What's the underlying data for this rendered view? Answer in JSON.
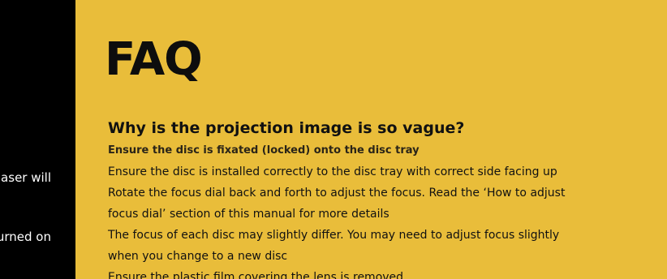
{
  "sidebar": {
    "lines": [
      "laser will",
      "urned on"
    ]
  },
  "faq": {
    "title": "FAQ",
    "question": "Why is the projection image is so vague?",
    "subheading": "Ensure the disc is fixated (locked) onto the disc tray",
    "lines": [
      "Ensure the disc is installed correctly to the disc tray with correct side facing up",
      "Rotate the focus dial back and forth to adjust the focus. Read the ‘How to adjust",
      "focus dial’ section of this manual for more details",
      "The focus of each disc may slightly differ. You may need to adjust focus slightly",
      "when you change to a new disc",
      "Ensure the plastic film covering the lens is removed"
    ]
  },
  "colors": {
    "background_main": "#e9bd3a",
    "background_sidebar": "#000000",
    "text_dark": "#111111",
    "text_light": "#ffffff"
  }
}
